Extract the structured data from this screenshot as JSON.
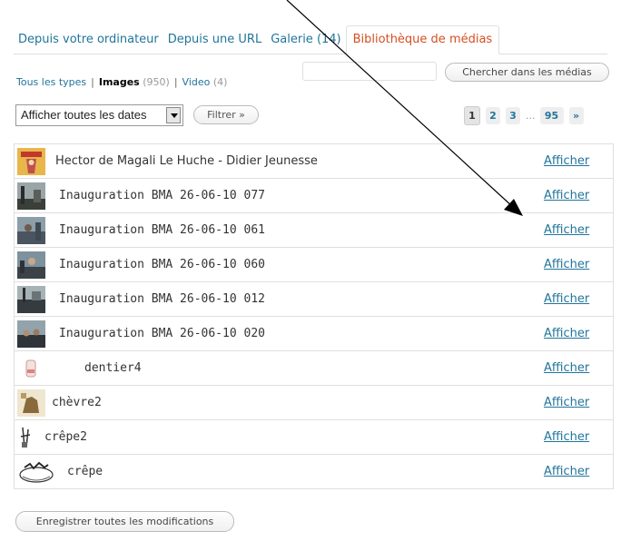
{
  "tabs": [
    {
      "label": "Depuis votre ordinateur",
      "active": false
    },
    {
      "label": "Depuis une URL",
      "active": false
    },
    {
      "label": "Galerie (14)",
      "active": false
    },
    {
      "label": "Bibliothèque de médias",
      "active": true
    }
  ],
  "type_filter": {
    "all": "Tous les types",
    "images": "Images",
    "images_count": "(950)",
    "video": "Video",
    "video_count": "(4)",
    "separator": "|"
  },
  "search": {
    "value": "",
    "button_label": "Chercher dans les médias"
  },
  "date_filter": {
    "selected": "Afficher toutes les dates",
    "button_label": "Filtrer »"
  },
  "pagination": {
    "pages": [
      "1",
      "2",
      "3"
    ],
    "current": "1",
    "ellipsis": "...",
    "last": "95",
    "next": "»"
  },
  "media_items": [
    {
      "title": "Hector de Magali Le Huche - Didier Jeunesse",
      "action": "Afficher"
    },
    {
      "title": "Inauguration BMA 26-06-10 077",
      "action": "Afficher"
    },
    {
      "title": "Inauguration BMA 26-06-10 061",
      "action": "Afficher"
    },
    {
      "title": "Inauguration BMA 26-06-10 060",
      "action": "Afficher"
    },
    {
      "title": "Inauguration BMA 26-06-10 012",
      "action": "Afficher"
    },
    {
      "title": "Inauguration BMA 26-06-10 020",
      "action": "Afficher"
    },
    {
      "title": "dentier4",
      "action": "Afficher"
    },
    {
      "title": "chèvre2",
      "action": "Afficher"
    },
    {
      "title": "crêpe2",
      "action": "Afficher"
    },
    {
      "title": "crêpe",
      "action": "Afficher"
    }
  ],
  "save_button": "Enregistrer toutes les modifications",
  "colors": {
    "link": "#21759b",
    "active_tab": "#d54e21",
    "border": "#dfdfdf"
  }
}
